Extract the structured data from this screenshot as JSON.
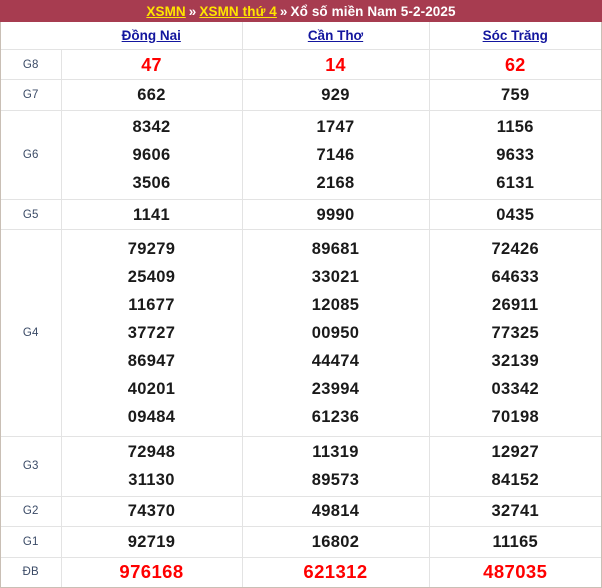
{
  "header": {
    "link1": "XSMN",
    "sep1": "»",
    "link2": "XSMN thứ 4",
    "sep2": "»",
    "tail": "Xổ số miền Nam 5-2-2025",
    "bg_color": "#a73c50",
    "link_color": "#ffe500",
    "text_color": "#ffffff"
  },
  "table": {
    "corner_label": "",
    "provinces": [
      "Đồng Nai",
      "Cần Thơ",
      "Sóc Trăng"
    ],
    "province_color": "#13169e",
    "highlight_color": "#ff0000",
    "number_color": "#1a1a1a",
    "rows": [
      {
        "label": "G8",
        "highlight": true,
        "values": [
          [
            "47"
          ],
          [
            "14"
          ],
          [
            "62"
          ]
        ]
      },
      {
        "label": "G7",
        "highlight": false,
        "values": [
          [
            "662"
          ],
          [
            "929"
          ],
          [
            "759"
          ]
        ]
      },
      {
        "label": "G6",
        "highlight": false,
        "values": [
          [
            "8342",
            "9606",
            "3506"
          ],
          [
            "1747",
            "7146",
            "2168"
          ],
          [
            "1156",
            "9633",
            "6131"
          ]
        ]
      },
      {
        "label": "G5",
        "highlight": false,
        "values": [
          [
            "1141"
          ],
          [
            "9990"
          ],
          [
            "0435"
          ]
        ]
      },
      {
        "label": "G4",
        "highlight": false,
        "values": [
          [
            "79279",
            "25409",
            "11677",
            "37727",
            "86947",
            "40201",
            "09484"
          ],
          [
            "89681",
            "33021",
            "12085",
            "00950",
            "44474",
            "23994",
            "61236"
          ],
          [
            "72426",
            "64633",
            "26911",
            "77325",
            "32139",
            "03342",
            "70198"
          ]
        ]
      },
      {
        "label": "G3",
        "highlight": false,
        "values": [
          [
            "72948",
            "31130"
          ],
          [
            "11319",
            "89573"
          ],
          [
            "12927",
            "84152"
          ]
        ]
      },
      {
        "label": "G2",
        "highlight": false,
        "values": [
          [
            "74370"
          ],
          [
            "49814"
          ],
          [
            "32741"
          ]
        ]
      },
      {
        "label": "G1",
        "highlight": false,
        "values": [
          [
            "92719"
          ],
          [
            "16802"
          ],
          [
            "11165"
          ]
        ]
      },
      {
        "label": "ĐB",
        "highlight": true,
        "values": [
          [
            "976168"
          ],
          [
            "621312"
          ],
          [
            "487035"
          ]
        ]
      }
    ]
  }
}
